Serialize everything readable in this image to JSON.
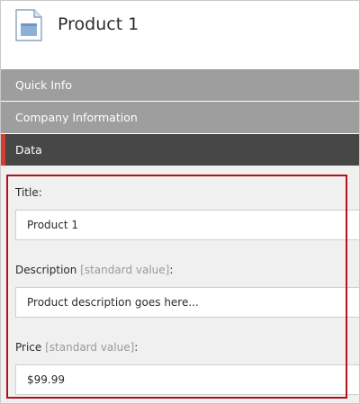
{
  "header": {
    "title": "Product 1",
    "icon": "document-icon"
  },
  "sections": [
    {
      "label": "Quick Info",
      "state": "collapsed"
    },
    {
      "label": "Company Information",
      "state": "collapsed"
    },
    {
      "label": "Data",
      "state": "expanded"
    }
  ],
  "fields": {
    "title": {
      "label": "Title:",
      "value": "Product 1"
    },
    "description": {
      "label": "Description",
      "standard_note": "[standard value]",
      "suffix": ":",
      "value": "Product description goes here..."
    },
    "price": {
      "label": "Price",
      "standard_note": "[standard value]",
      "suffix": ":",
      "value": "$99.99"
    }
  },
  "colors": {
    "section_collapsed_bg": "#9e9e9e",
    "section_active_bg": "#474747",
    "active_accent": "#d63b2f",
    "highlight_border": "#b1121c",
    "content_bg": "#f0f0f0"
  }
}
